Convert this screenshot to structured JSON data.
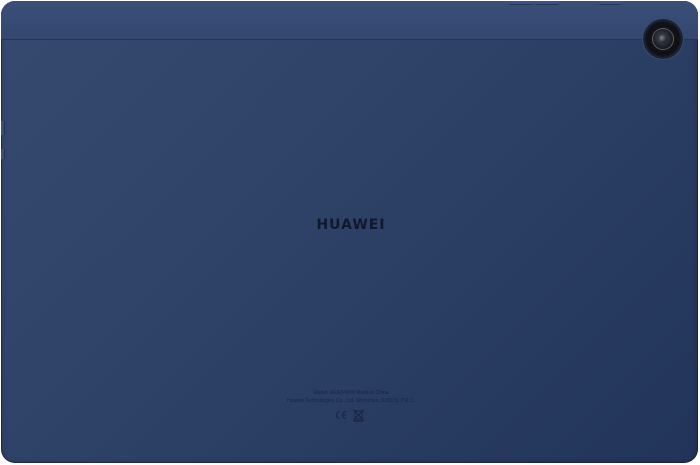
{
  "device": {
    "brand_logo": "HUAWEI",
    "color": "#2f4369",
    "regulatory_line_1": "Model: AGS3-W09   Made in China",
    "regulatory_line_2": "Huawei Technologies Co., Ltd.  Shenzhen, 518129, P.R.C.",
    "certification_marks": [
      "CE-mark-icon",
      "weee-bin-icon"
    ]
  }
}
